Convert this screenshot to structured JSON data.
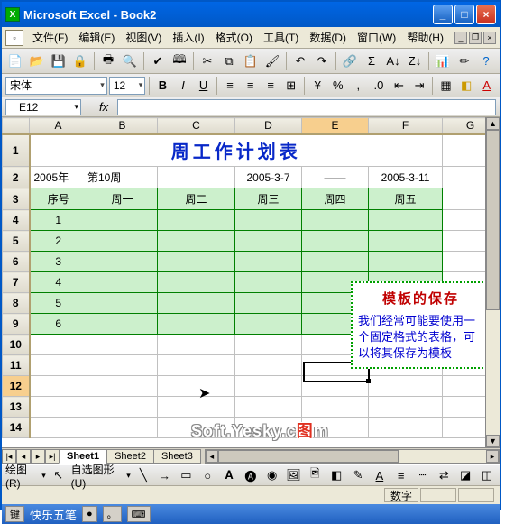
{
  "titlebar": {
    "app": "Microsoft Excel",
    "doc": "Book2"
  },
  "menu": {
    "file": "文件(F)",
    "edit": "编辑(E)",
    "view": "视图(V)",
    "insert": "插入(I)",
    "format": "格式(O)",
    "tools": "工具(T)",
    "data": "数据(D)",
    "window": "窗口(W)",
    "help": "帮助(H)"
  },
  "font": {
    "name": "宋体",
    "size": "12"
  },
  "namebox": "E12",
  "fx_label": "fx",
  "cols": [
    "A",
    "B",
    "C",
    "D",
    "E",
    "F",
    "G"
  ],
  "active_col": "E",
  "rows": [
    "1",
    "2",
    "3",
    "4",
    "5",
    "6",
    "7",
    "8",
    "9",
    "10",
    "11",
    "12",
    "13",
    "14"
  ],
  "plan_title": "周工作计划表",
  "row2": {
    "year": "2005年",
    "week": "第10周",
    "d1": "2005-3-7",
    "dash": "——",
    "d2": "2005-3-11"
  },
  "headers": {
    "no": "序号",
    "mon": "周一",
    "tue": "周二",
    "wed": "周三",
    "thu": "周四",
    "fri": "周五"
  },
  "seq": [
    "1",
    "2",
    "3",
    "4",
    "5",
    "6"
  ],
  "callout": {
    "title": "模板的保存",
    "body": "我们经常可能要使用一个固定格式的表格，可以将其保存为模板"
  },
  "watermark": {
    "t1": "Soft.Yesky.c",
    "t2": "图",
    "t3": "m"
  },
  "sheets": [
    "Sheet1",
    "Sheet2",
    "Sheet3"
  ],
  "active_sheet": "Sheet1",
  "drawbar": {
    "draw": "绘图(R)",
    "autoshape": "自选图形(U)"
  },
  "status": {
    "nums": "数字"
  },
  "ime": {
    "name": "快乐五笔"
  }
}
